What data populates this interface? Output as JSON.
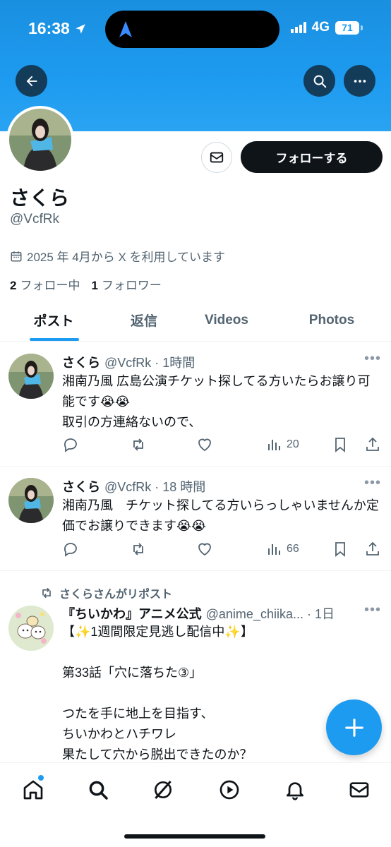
{
  "status_bar": {
    "time": "16:38",
    "network": "4G",
    "battery": "71"
  },
  "profile": {
    "follow_label": "フォローする",
    "display_name": "さくら",
    "handle": "@VcfRk",
    "joined": "2025 年 4月から X を利用しています",
    "following_count": "2",
    "following_label": "フォロー中",
    "followers_count": "1",
    "followers_label": "フォロワー"
  },
  "tabs": [
    {
      "label": "ポスト"
    },
    {
      "label": "返信"
    },
    {
      "label": "Videos"
    },
    {
      "label": "Photos"
    }
  ],
  "posts": [
    {
      "name": "さくら",
      "meta": "@VcfRk · 1時間",
      "text": "湘南乃風 広島公演チケット探してる方いたらお譲り可能です😭😭\n取引の方連絡ないので、",
      "views": "20"
    },
    {
      "name": "さくら",
      "meta": "@VcfRk · 18 時間",
      "text": "湘南乃風　チケット探してる方いらっしゃいませんか定価でお譲りできます😭😭",
      "views": "66"
    },
    {
      "repost_label": "さくらさんがリポスト",
      "name": "『ちいかわ』アニメ公式",
      "meta": "@anime_chiika... · 1日",
      "text": "【✨1週間限定見逃し配信中✨】\n\n第33話「穴に落ちた③」\n\nつたを手に地上を目指す、\nちいかわとハチワレ\n果たして穴から脱出できたのか？"
    }
  ],
  "colors": {
    "accent": "#1d9bf0",
    "text": "#0f1419",
    "muted": "#536471"
  }
}
